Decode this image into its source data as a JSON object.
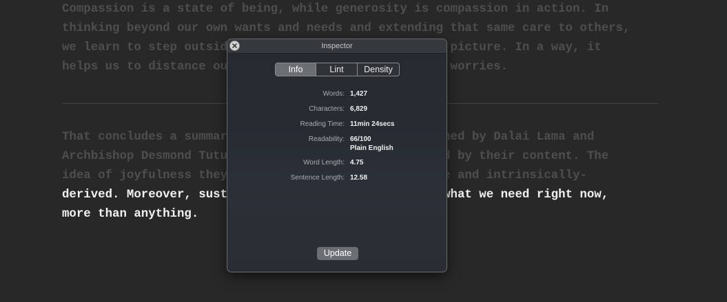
{
  "editor": {
    "paragraph1": [
      "Compassion is a state of being, while generosity is compassion in action. In",
      "thinking beyond our own wants and needs and extending that same care to others,",
      "we learn to step outside ourselves and see the bigger picture. In a way, it",
      "helps us to distance ourselves from our own fears and worries."
    ],
    "paragraph2_dim": [
      "That concludes a summary of the eight pillars as defined by Dalai Lama and",
      "Archbishop Desmond Tutu. I hope that you will be moved by their content. The",
      "idea of joyfulness they describe feels both attainable and intrinsically-"
    ],
    "paragraph2_active": [
      "derived. Moreover, sustainable joy and compassion is what we need right now,",
      "more than anything."
    ]
  },
  "inspector": {
    "title": "Inspector",
    "close_icon": "close-icon",
    "tabs": [
      {
        "label": "Info",
        "selected": true
      },
      {
        "label": "Lint",
        "selected": false
      },
      {
        "label": "Density",
        "selected": false
      }
    ],
    "stats": [
      {
        "label": "Words:",
        "value": "1,427"
      },
      {
        "label": "Characters:",
        "value": "6,829"
      },
      {
        "label": "Reading Time:",
        "value": "11min 24secs"
      },
      {
        "label": "Readability:",
        "value": "66/100",
        "detail": "Plain English"
      },
      {
        "label": "Word Length:",
        "value": "4.75"
      },
      {
        "label": "Sentence Length:",
        "value": "12.58"
      }
    ],
    "update_label": "Update"
  },
  "colors": {
    "background": "#282828",
    "dim_text": "#4e4e4e",
    "active_text": "#f2f2f2",
    "selected_tab": "#6b6e73"
  }
}
